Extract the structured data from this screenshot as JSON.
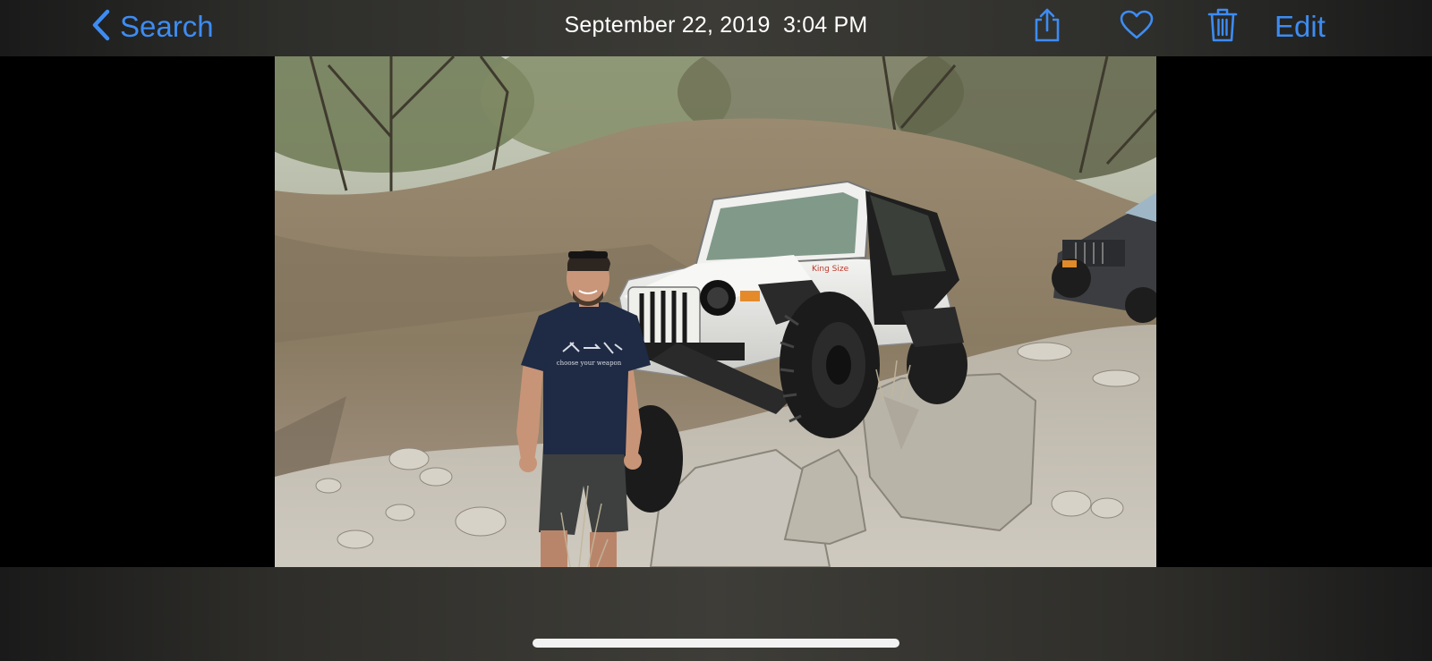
{
  "nav": {
    "back_label": "Search",
    "title": "September 22, 2019  3:04 PM",
    "edit_label": "Edit",
    "icons": [
      "chevron-left-icon",
      "share-icon",
      "heart-icon",
      "trash-icon"
    ]
  },
  "photo": {
    "description_icon": "photo-image",
    "shirt_text": "choose your weapon",
    "sticker_text": "King Size"
  },
  "colors": {
    "accent": "#3d8cf3",
    "bar_background": "#3c3b36",
    "background": "#000000"
  }
}
